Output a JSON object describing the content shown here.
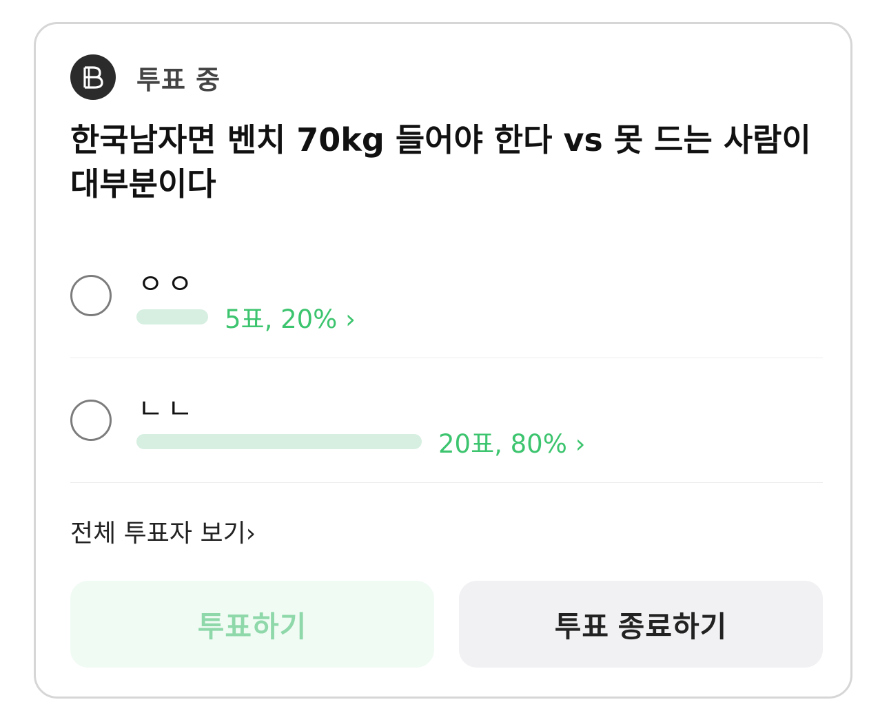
{
  "poll": {
    "status": "투표 중",
    "question": "한국남자면 벤치 70kg 들어야 한다 vs 못 드는 사람이 대부분이다",
    "options": [
      {
        "label": "ㅇㅇ",
        "result": "5표, 20% ›",
        "fraction": 0.2
      },
      {
        "label": "ㄴㄴ",
        "result": "20표, 80% ›",
        "fraction": 0.8
      }
    ],
    "view_all": "전체 투표자 보기›",
    "vote_button": "투표하기",
    "end_button": "투표 종료하기"
  },
  "colors": {
    "accent": "#3cc46e",
    "bar": "#d6efe1",
    "badge": "#2b2b2b"
  },
  "icons": {
    "status": "vote-badge-icon",
    "chevron": "chevron-right-icon"
  }
}
